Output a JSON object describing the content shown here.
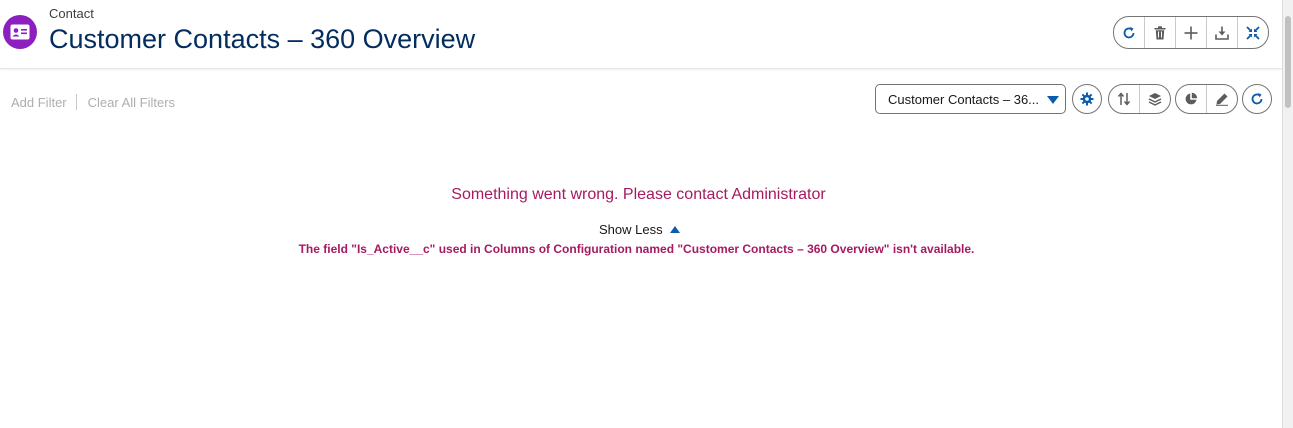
{
  "header": {
    "object_label": "Contact",
    "title": "Customer Contacts – 360 Overview",
    "object_icon": "contact-card-icon",
    "actions": [
      "refresh-icon",
      "delete-icon",
      "add-icon",
      "download-icon",
      "collapse-icon"
    ]
  },
  "filters": {
    "add_filter": "Add Filter",
    "clear_all": "Clear All Filters"
  },
  "view_select": {
    "value": "Customer Contacts – 36..."
  },
  "toolbar_icons": [
    "settings-icon",
    "sort-icon",
    "layers-icon",
    "pie-chart-icon",
    "edit-icon",
    "refresh-icon"
  ],
  "error": {
    "message": "Something went wrong. Please contact Administrator",
    "toggle_label": "Show Less",
    "detail": "The field \"Is_Active__c\" used in Columns of Configuration named \"Customer Contacts – 360 Overview\" isn't available."
  },
  "colors": {
    "brand_icon": "#8b1fbf",
    "title": "#032d60",
    "error": "#a61a61",
    "accent": "#0b5cab"
  }
}
